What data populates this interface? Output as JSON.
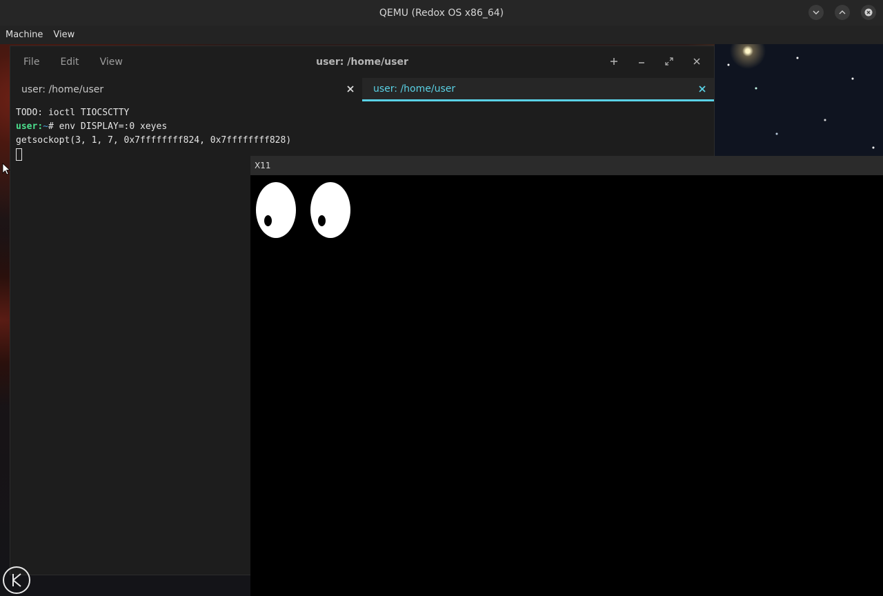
{
  "host": {
    "title": "QEMU (Redox OS x86_64)",
    "menu": [
      "Machine",
      "View"
    ],
    "controls": [
      "chevron-down-icon",
      "chevron-up-icon",
      "close-icon"
    ]
  },
  "terminal": {
    "menu": [
      "File",
      "Edit",
      "View"
    ],
    "title": "user: /home/user",
    "controls": [
      "plus-icon",
      "minimize-icon",
      "maximize-icon",
      "close-icon"
    ],
    "tabs": [
      {
        "label": "user: /home/user",
        "active": false
      },
      {
        "label": "user: /home/user",
        "active": true
      }
    ],
    "lines": {
      "line1": "TODO: ioctl TIOCSCTTY",
      "prompt_user": "user",
      "prompt_sep": ":",
      "prompt_path": "~",
      "prompt_hash": "#",
      "command": " env DISPLAY=:0 xeyes",
      "line3": "getsockopt(3, 1, 7, 0x7ffffffff824, 0x7ffffffff828)"
    }
  },
  "x11": {
    "title": "X11"
  },
  "colors": {
    "accent": "#5ad2e6",
    "prompt_user": "#4ce08e"
  }
}
